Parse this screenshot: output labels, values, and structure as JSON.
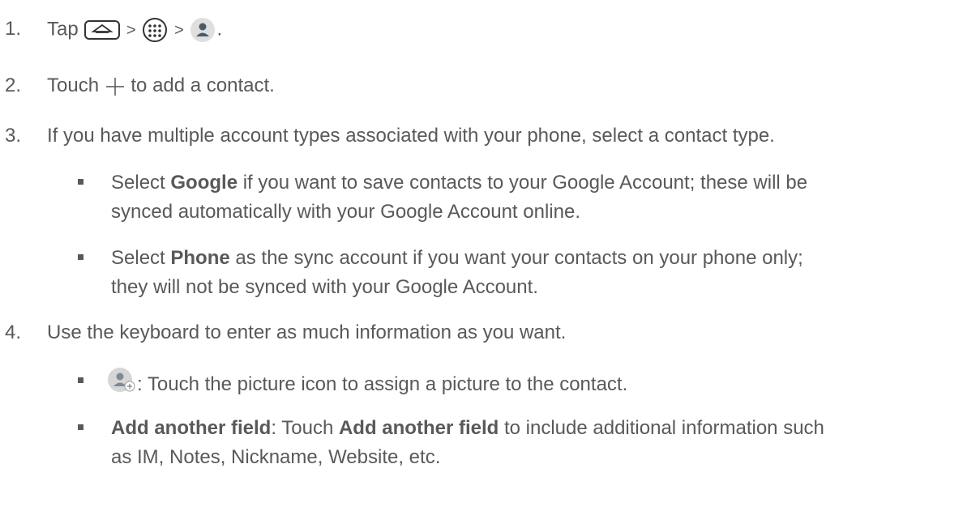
{
  "steps": [
    {
      "number": "1.",
      "prefix": "Tap",
      "sep1": ">",
      "sep2": ">",
      "suffix": ".",
      "icons": [
        "home-icon",
        "apps-icon",
        "contacts-icon"
      ]
    },
    {
      "number": "2.",
      "before": "Touch",
      "after": "to add a contact.",
      "icon": "plus-icon"
    },
    {
      "number": "3.",
      "text": "If you have multiple account types associated with your phone, select a contact type."
    },
    {
      "number": "4.",
      "text": "Use the keyboard to enter as much information as you want."
    }
  ],
  "step3_bullets": [
    {
      "pre": "Select",
      "bold": "Google",
      "line1": "if you want to save contacts to your Google Account; these will be",
      "line2": "synced automatically with your Google Account online."
    },
    {
      "pre": "Select",
      "bold": "Phone",
      "line1": "as the sync account if you want your contacts on your phone only;",
      "line2": "they will not be synced with your Google Account."
    }
  ],
  "step4_bullets": [
    {
      "icon": "add-picture-icon",
      "text": ": Touch the picture icon to assign a picture to the contact."
    },
    {
      "bold1": "Add another field",
      "mid": ": Touch",
      "bold2": "Add another field",
      "line1end": "to include additional information such",
      "line2": "as IM, Notes, Nickname, Website, etc."
    }
  ]
}
